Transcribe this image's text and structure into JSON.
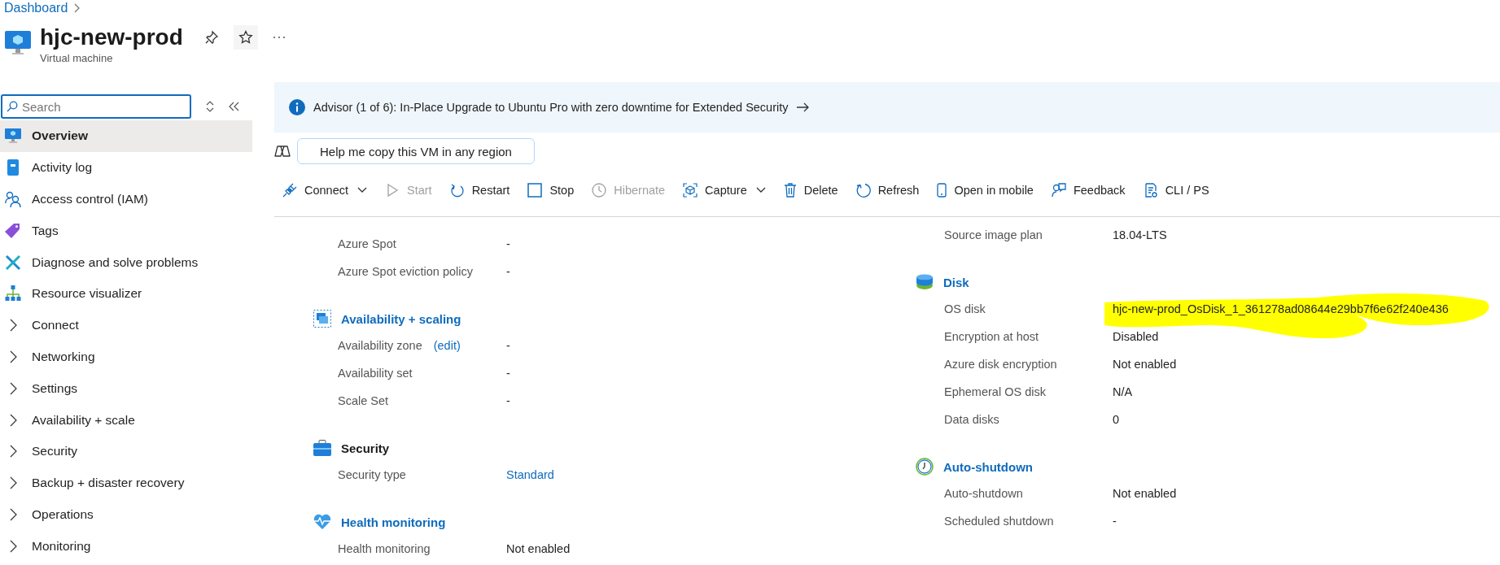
{
  "breadcrumb": {
    "label": "Dashboard"
  },
  "resource": {
    "title": "hjc-new-prod",
    "subtitle": "Virtual machine"
  },
  "sidebar": {
    "search": {
      "placeholder": "Search"
    },
    "items": [
      {
        "label": "Overview",
        "kind": "page",
        "selected": true
      },
      {
        "label": "Activity log",
        "kind": "page",
        "selected": false
      },
      {
        "label": "Access control (IAM)",
        "kind": "page",
        "selected": false
      },
      {
        "label": "Tags",
        "kind": "page",
        "selected": false
      },
      {
        "label": "Diagnose and solve problems",
        "kind": "page",
        "selected": false
      },
      {
        "label": "Resource visualizer",
        "kind": "page",
        "selected": false
      },
      {
        "label": "Connect",
        "kind": "group",
        "selected": false
      },
      {
        "label": "Networking",
        "kind": "group",
        "selected": false
      },
      {
        "label": "Settings",
        "kind": "group",
        "selected": false
      },
      {
        "label": "Availability + scale",
        "kind": "group",
        "selected": false
      },
      {
        "label": "Security",
        "kind": "group",
        "selected": false
      },
      {
        "label": "Backup + disaster recovery",
        "kind": "group",
        "selected": false
      },
      {
        "label": "Operations",
        "kind": "group",
        "selected": false
      },
      {
        "label": "Monitoring",
        "kind": "group",
        "selected": false
      }
    ]
  },
  "advisor": {
    "text": "Advisor (1 of 6): In-Place Upgrade to Ubuntu Pro with zero downtime for Extended Security"
  },
  "copilot": {
    "label": "Help me copy this VM in any region"
  },
  "toolbar": [
    {
      "label": "Connect",
      "disabled": false,
      "dropdown": true
    },
    {
      "label": "Start",
      "disabled": true,
      "dropdown": false
    },
    {
      "label": "Restart",
      "disabled": false,
      "dropdown": false
    },
    {
      "label": "Stop",
      "disabled": false,
      "dropdown": false
    },
    {
      "label": "Hibernate",
      "disabled": true,
      "dropdown": false
    },
    {
      "label": "Capture",
      "disabled": false,
      "dropdown": true
    },
    {
      "label": "Delete",
      "disabled": false,
      "dropdown": false
    },
    {
      "label": "Refresh",
      "disabled": false,
      "dropdown": false
    },
    {
      "label": "Open in mobile",
      "disabled": false,
      "dropdown": false
    },
    {
      "label": "Feedback",
      "disabled": false,
      "dropdown": false
    },
    {
      "label": "CLI / PS",
      "disabled": false,
      "dropdown": false
    }
  ],
  "columns": [
    {
      "sections": [
        {
          "rows": [
            {
              "label": "Azure Spot",
              "value": "-"
            },
            {
              "label": "Azure Spot eviction policy",
              "value": "-"
            }
          ]
        },
        {
          "kind": "availability",
          "title": "Availability + scaling",
          "link": true,
          "rows": [
            {
              "label": "Availability zone",
              "edit": "(edit)",
              "value": "-"
            },
            {
              "label": "Availability set",
              "value": "-"
            },
            {
              "label": "Scale Set",
              "value": "-"
            }
          ]
        },
        {
          "kind": "security",
          "title": "Security",
          "link": false,
          "rows": [
            {
              "label": "Security type",
              "value": "Standard",
              "value_link": true
            }
          ]
        },
        {
          "kind": "health",
          "title": "Health monitoring",
          "link": true,
          "rows": [
            {
              "label": "Health monitoring",
              "value": "Not enabled"
            }
          ]
        }
      ]
    },
    {
      "sections": [
        {
          "rows": [
            {
              "label": "Source image plan",
              "value": "18.04-LTS"
            }
          ]
        },
        {
          "kind": "disk",
          "title": "Disk",
          "link": true,
          "rows": [
            {
              "label": "OS disk",
              "value": "hjc-new-prod_OsDisk_1_361278ad08644e29bb7f6e62f240e436",
              "highlighted": true
            },
            {
              "label": "Encryption at host",
              "value": "Disabled"
            },
            {
              "label": "Azure disk encryption",
              "value": "Not enabled"
            },
            {
              "label": "Ephemeral OS disk",
              "value": "N/A"
            },
            {
              "label": "Data disks",
              "value": "0"
            }
          ]
        },
        {
          "kind": "clock",
          "title": "Auto-shutdown",
          "link": true,
          "rows": [
            {
              "label": "Auto-shutdown",
              "value": "Not enabled"
            },
            {
              "label": "Scheduled shutdown",
              "value": "-"
            }
          ]
        }
      ]
    }
  ]
}
